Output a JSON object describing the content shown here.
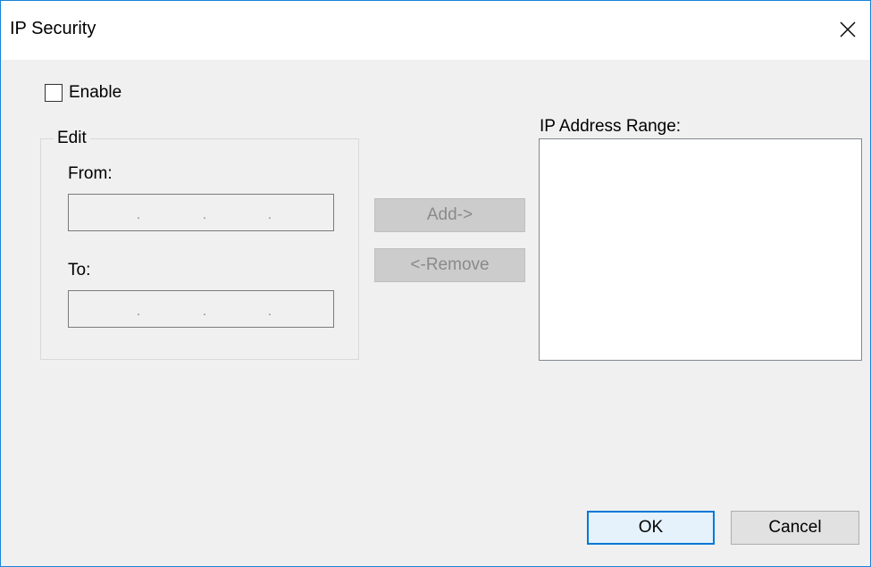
{
  "window": {
    "title": "IP Security",
    "close_icon": "close-x-icon"
  },
  "enable": {
    "label": "Enable",
    "checked": false
  },
  "edit_group": {
    "title": "Edit",
    "from_label": "From:",
    "to_label": "To:",
    "from_value": ".      .      .",
    "to_value": ".      .      ."
  },
  "buttons": {
    "add": "Add->",
    "remove": "<-Remove",
    "ok": "OK",
    "cancel": "Cancel"
  },
  "range": {
    "label": "IP Address Range:",
    "items": []
  },
  "colors": {
    "accent": "#0078d7",
    "window_border": "#1883d7",
    "dialog_bg": "#f0f0f0"
  }
}
